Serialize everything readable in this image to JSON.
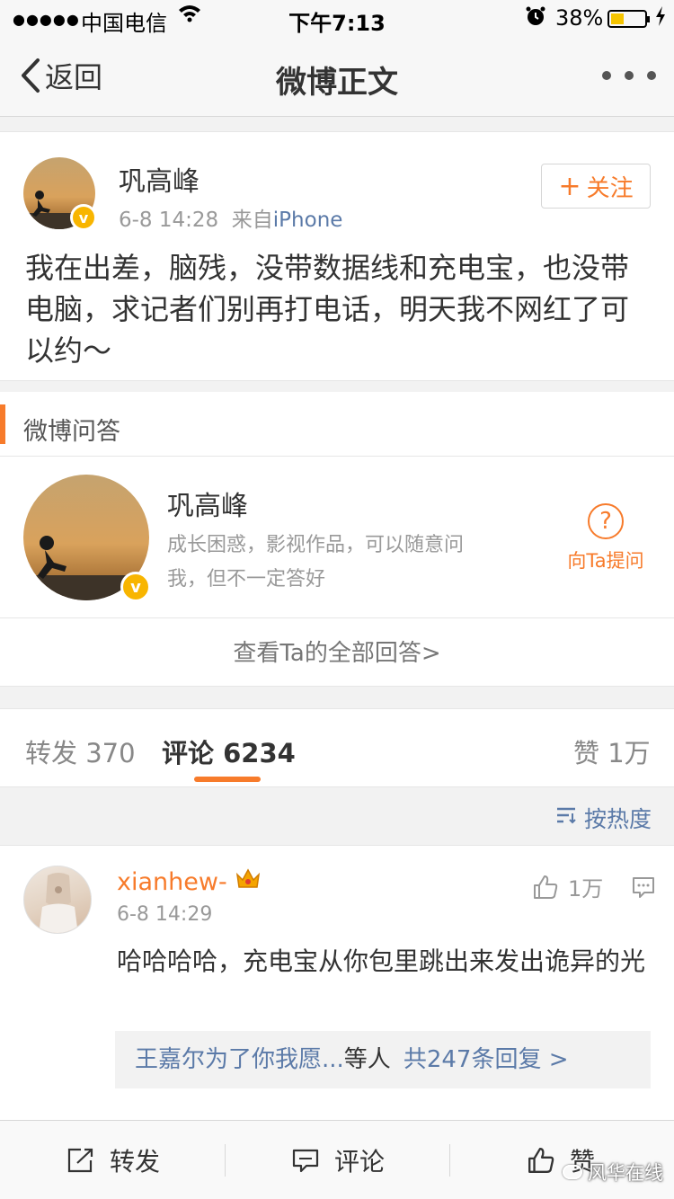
{
  "status_bar": {
    "signal": "●●●●●",
    "carrier": "中国电信",
    "time": "下午7:13",
    "battery_percent": "38%",
    "battery_level": 0.38
  },
  "nav": {
    "back_label": "返回",
    "title": "微博正文"
  },
  "post": {
    "author": "巩高峰",
    "date": "6-8 14:28",
    "source_prefix": "来自",
    "source": "iPhone",
    "follow_label": "关注",
    "text": "我在出差，脑残，没带数据线和充电宝，也没带电脑，求记者们别再打电话，明天我不网红了可以约～"
  },
  "qa": {
    "section_title": "微博问答",
    "name": "巩高峰",
    "description": "成长困惑，影视作品，可以随意问我，但不一定答好",
    "ask_label": "向Ta提问",
    "view_all": "查看Ta的全部回答>"
  },
  "tabs": [
    {
      "label": "转发 370"
    },
    {
      "label": "评论 6234"
    },
    {
      "label": "赞 1万"
    }
  ],
  "sort_label": "按热度",
  "comment": {
    "user": "xianhew-",
    "time": "6-8 14:29",
    "likes": "1万",
    "text": "哈哈哈哈，充电宝从你包里跳出来发出诡异的光",
    "reply_users": "王嘉尔为了你我愿...",
    "reply_suffix": "等人",
    "reply_count": "共247条回复 >"
  },
  "toolbar": {
    "repost": "转发",
    "comment": "评论",
    "like": "赞"
  },
  "watermark": "风华在线",
  "colors": {
    "accent": "#f77b2b",
    "link": "#5b7aa8",
    "verified": "#f8b500"
  }
}
